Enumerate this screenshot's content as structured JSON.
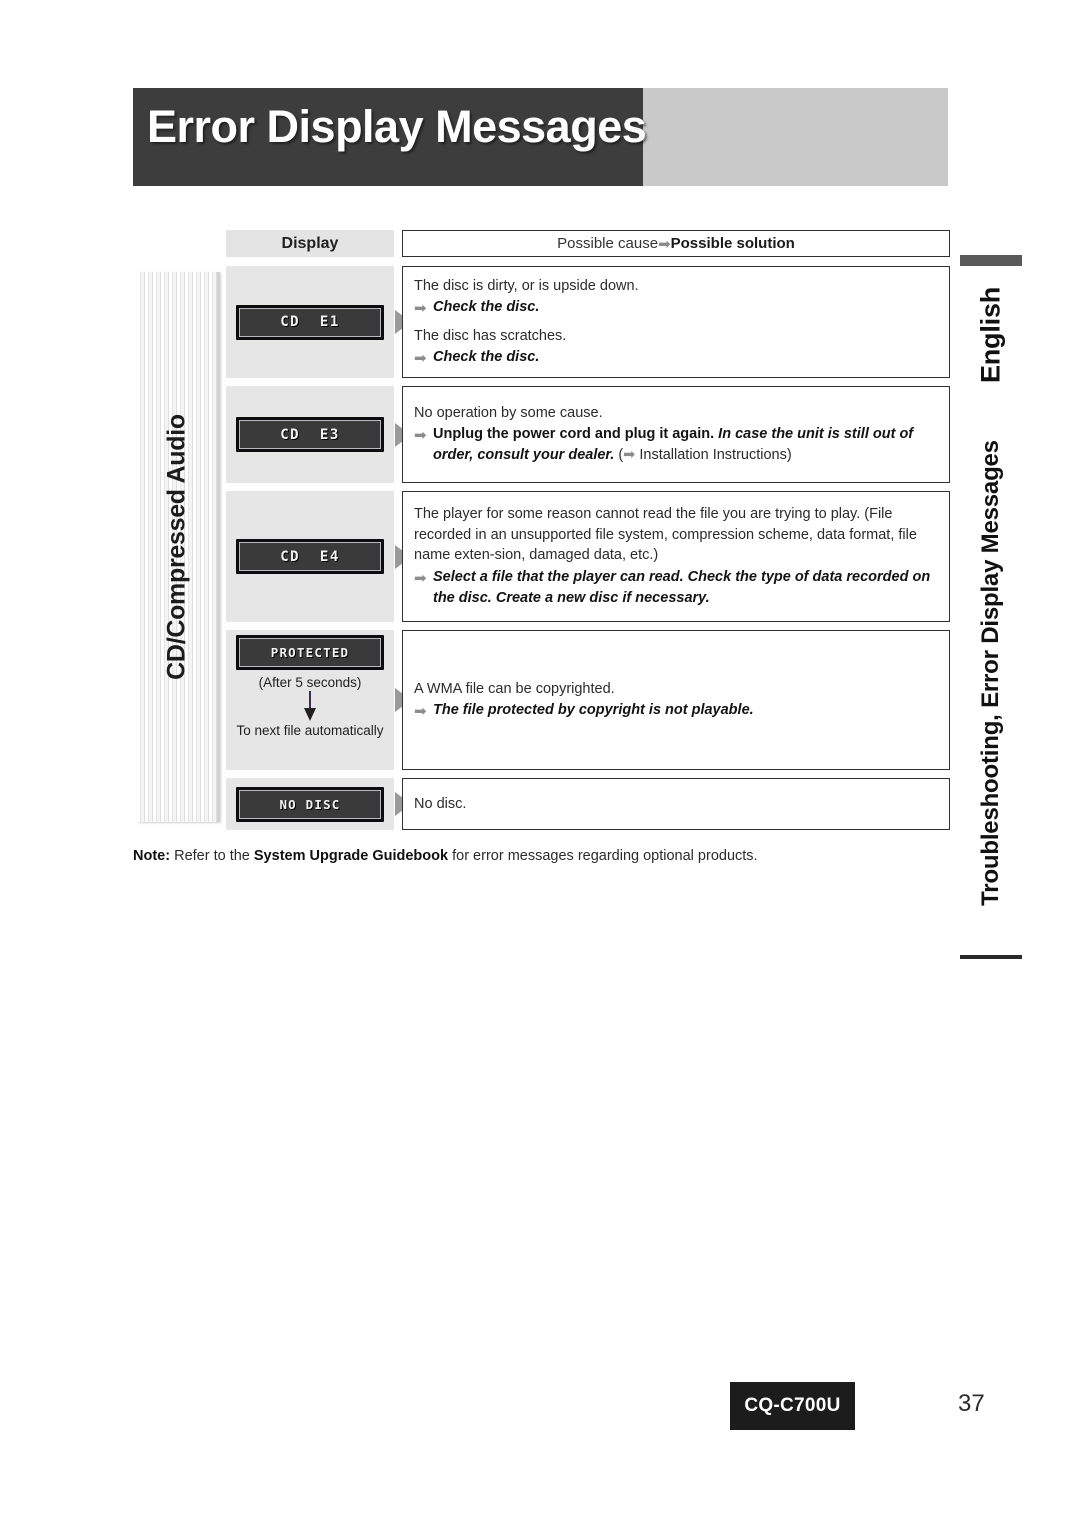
{
  "header": {
    "title": "Error Display Messages"
  },
  "side_tabs": {
    "left_label": "CD/Compressed Audio",
    "right_language": "English",
    "right_section": "Troubleshooting, Error Display Messages"
  },
  "table": {
    "headers": {
      "display": "Display",
      "cause_prefix": "Possible cause ",
      "cause_arrow": "➡",
      "cause_suffix": " Possible solution"
    },
    "rows": [
      {
        "display_text": "CD  E1",
        "blocks": [
          {
            "cause": "The disc is dirty, or is upside down.",
            "solution": "Check the disc."
          },
          {
            "cause": "The disc has scratches.",
            "solution": "Check the disc."
          }
        ]
      },
      {
        "display_text": "CD  E3",
        "blocks": [
          {
            "cause": "No operation by some cause.",
            "solution_bold": "Unplug the power cord and plug it again. ",
            "solution_italic": "In case the unit is still out of order, consult your dealer.",
            "solution_tail_prefix": " (",
            "solution_tail_arrow": "➡",
            "solution_tail": " Installation Instructions)"
          }
        ]
      },
      {
        "display_text": "CD  E4",
        "blocks": [
          {
            "cause": "The player for some reason cannot read the file you are trying to play. (File recorded in an unsupported file system, compression scheme, data format, file name exten-sion, damaged data, etc.)",
            "solution": "Select a file that the player can read. Check the type of data recorded on the disc. Create a new disc if necessary."
          }
        ]
      },
      {
        "display_text": "PROTECTED",
        "sub_note": "(After 5 seconds)",
        "sub_note2": "To next file automatically",
        "blocks": [
          {
            "cause": "A WMA file can be copyrighted.",
            "solution": "The file protected by copyright is not playable."
          }
        ]
      },
      {
        "display_text": "NO DISC",
        "blocks": [
          {
            "cause": "No disc."
          }
        ]
      }
    ]
  },
  "note": {
    "label": "Note:",
    "text_before": " Refer to the ",
    "bold_title": "System Upgrade Guidebook",
    "text_after": " for error messages regarding optional products."
  },
  "footer": {
    "model": "CQ-C700U",
    "page": "37"
  },
  "colors": {
    "header_dark": "#3d3d3d",
    "header_light": "#c9c9c9",
    "display_cell": "#e6e6e6",
    "lcd_screen": "#3a3a3a",
    "triangle": "#9a9a9a"
  }
}
